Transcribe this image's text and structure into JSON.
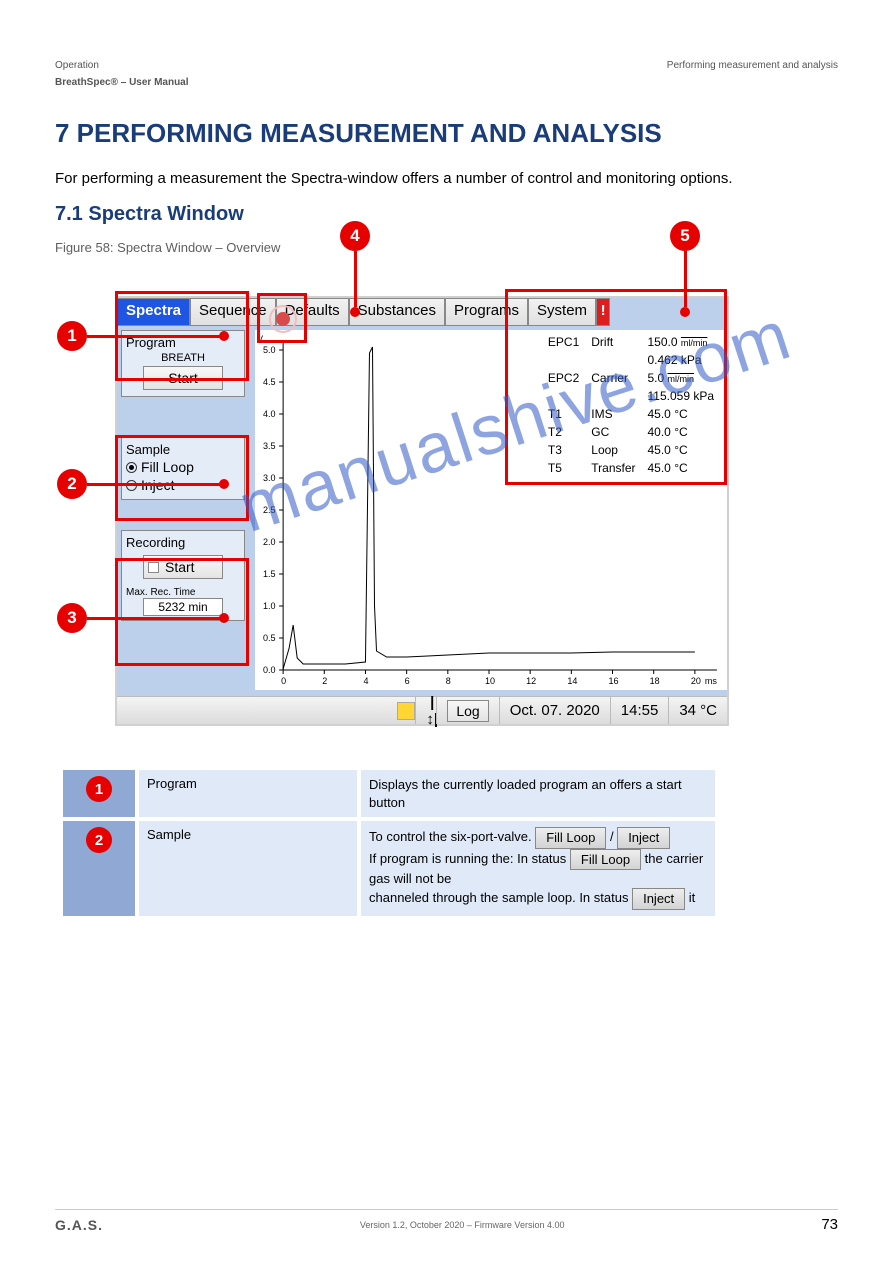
{
  "page": {
    "breadcrumb_left": "Operation",
    "breadcrumb_right": "Performing measurement and analysis",
    "doc_title": "BreathSpec® – User Manual",
    "page_number": "73",
    "footer_line": "Version 1.2, October 2020 – Firmware Version 4.00",
    "brand": "G.A.S."
  },
  "section": {
    "h1": "7 PERFORMING MEASUREMENT AND ANALYSIS",
    "p1": "For performing a measurement the Spectra-window offers a number of control and monitoring options.",
    "h2": "7.1 Spectra Window",
    "fig_caption": "Figure 58: Spectra Window – Overview"
  },
  "tabs": {
    "t1": "Spectra",
    "t2": "Sequence",
    "t3": "Defaults",
    "t4": "Substances",
    "t5": "Programs",
    "t6": "System",
    "t7": "!"
  },
  "program": {
    "title": "Program",
    "name": "BREATH",
    "start": "Start"
  },
  "sample": {
    "title": "Sample",
    "fill": "Fill Loop",
    "inject": "Inject"
  },
  "recording": {
    "title": "Recording",
    "start": "Start",
    "label": "Max. Rec. Time",
    "val": "5232 min"
  },
  "readout": {
    "epc1_name": "EPC1",
    "epc1_typ": "Drift",
    "epc1_v1": "150.0",
    "epc1_u1": "ml/min",
    "epc1_v2": "0.462 kPa",
    "epc2_name": "EPC2",
    "epc2_typ": "Carrier",
    "epc2_v1": "5.0",
    "epc2_u1": "ml/min",
    "epc2_v2": "115.059 kPa",
    "t1n": "T1",
    "t1t": "IMS",
    "t1v": "45.0 °C",
    "t2n": "T2",
    "t2t": "GC",
    "t2v": "40.0 °C",
    "t3n": "T3",
    "t3t": "Loop",
    "t3v": "45.0 °C",
    "t5n": "T5",
    "t5t": "Transfer",
    "t5v": "45.0 °C"
  },
  "status": {
    "log": "Log",
    "date": "Oct. 07. 2020",
    "time": "14:55",
    "temp": "34 °C",
    "bars": "|↕|"
  },
  "legend": {
    "r1_name": "Program",
    "r1_desc": "Displays the currently loaded program an offers a start button",
    "r2_name": "Sample",
    "r2_p1": "To control the six-port-valve.",
    "r2_fill": "Fill Loop",
    "r2_inject": "Inject",
    "r2_p2": "If program is running the",
    "r2_p2_fill": "Fill Loop",
    "r2_p2b": ": In status",
    "r2_p2c": "the carrier gas will not be",
    "r2_p3": "channeled through the sample loop. In status",
    "r2_p3_inj": "Inject",
    "r2_p3b": "it"
  },
  "callout": {
    "c1": "1",
    "c2": "2",
    "c3": "3",
    "c4": "4",
    "c5": "5"
  },
  "chart_data": {
    "type": "line",
    "title": "",
    "xlabel": "ms",
    "ylabel": "V",
    "x": [
      0.0,
      0.3,
      0.5,
      0.7,
      1.0,
      2.0,
      3.0,
      4.0,
      4.2,
      4.3,
      4.4,
      4.5,
      5.0,
      6.0,
      7.0,
      8.0,
      10.0,
      12.0,
      14.0,
      16.0,
      18.0,
      20.0
    ],
    "y": [
      0.02,
      0.35,
      0.7,
      0.18,
      0.1,
      0.1,
      0.1,
      0.12,
      4.95,
      5.05,
      1.0,
      0.3,
      0.2,
      0.2,
      0.22,
      0.24,
      0.26,
      0.27,
      0.27,
      0.28,
      0.28,
      0.28
    ],
    "xlim": [
      0,
      21
    ],
    "ylim": [
      0.0,
      5.1
    ],
    "xticks": [
      0,
      2,
      4,
      6,
      8,
      10,
      12,
      14,
      16,
      18,
      20
    ],
    "yticks": [
      0.0,
      0.5,
      1.0,
      1.5,
      2.0,
      2.5,
      3.0,
      3.5,
      4.0,
      4.5,
      5.0
    ]
  },
  "watermark": "manualshive.com"
}
